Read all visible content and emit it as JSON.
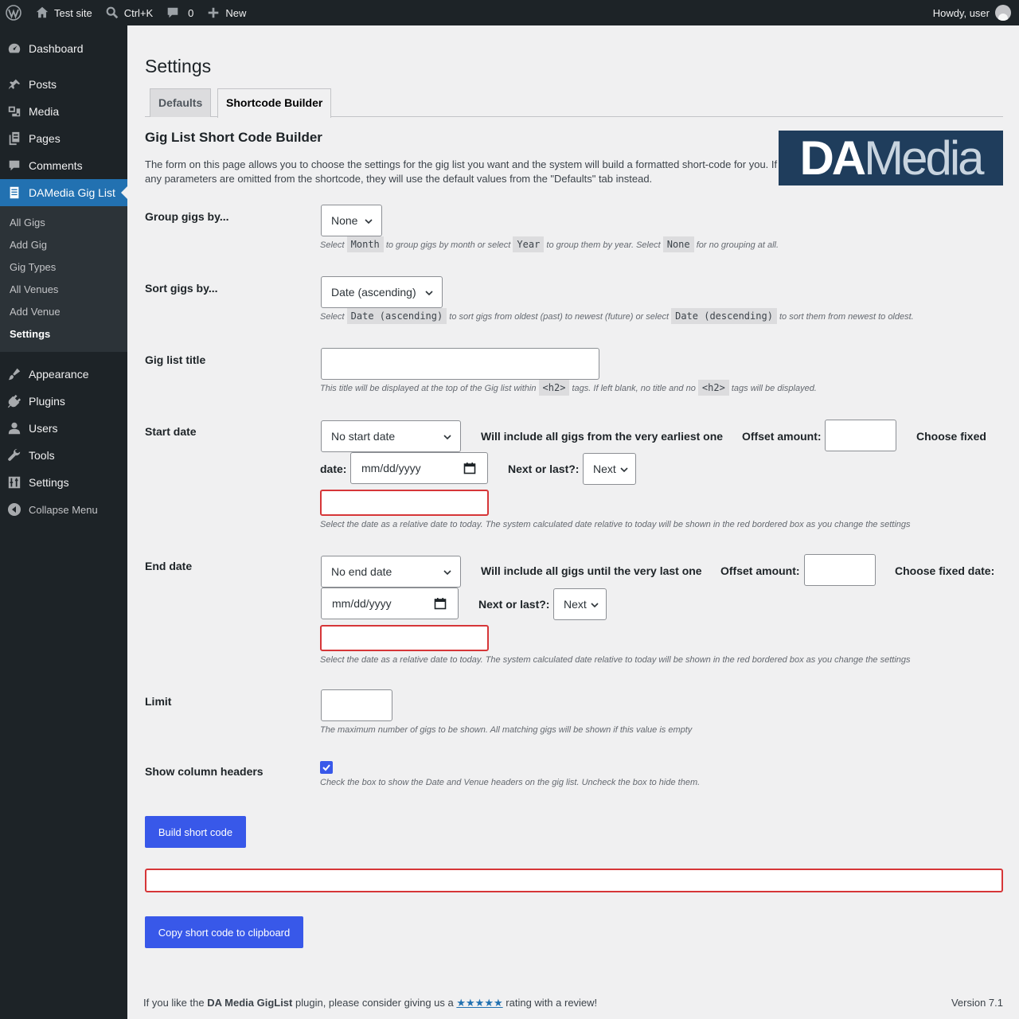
{
  "adminbar": {
    "site_name": "Test site",
    "search_shortcut": "Ctrl+K",
    "comments_count": "0",
    "new_label": "New",
    "howdy": "Howdy, user"
  },
  "sidebar": {
    "items": [
      {
        "label": "Dashboard"
      },
      {
        "label": "Posts"
      },
      {
        "label": "Media"
      },
      {
        "label": "Pages"
      },
      {
        "label": "Comments"
      },
      {
        "label": "DAMedia Gig List"
      },
      {
        "label": "Appearance"
      },
      {
        "label": "Plugins"
      },
      {
        "label": "Users"
      },
      {
        "label": "Tools"
      },
      {
        "label": "Settings"
      }
    ],
    "submenu": [
      "All Gigs",
      "Add Gig",
      "Gig Types",
      "All Venues",
      "Add Venue",
      "Settings"
    ],
    "collapse_label": "Collapse Menu"
  },
  "page": {
    "title": "Settings",
    "tabs": [
      {
        "label": "Defaults"
      },
      {
        "label": "Shortcode Builder"
      }
    ],
    "builder_title": "Gig List Short Code Builder",
    "intro": "The form on this page allows you to choose the settings for the gig list you want and the system will build a formatted short-code for you. If any parameters are omitted from the shortcode, they will use the default values from the \"Defaults\" tab instead.",
    "logo_bold": "DA",
    "logo_light": "Media"
  },
  "form": {
    "group": {
      "label": "Group gigs by...",
      "value": "None",
      "desc_1": "Select",
      "code_1": "Month",
      "desc_2": "to group gigs by month or select",
      "code_2": "Year",
      "desc_3": "to group them by year. Select",
      "code_3": "None",
      "desc_4": "for no grouping at all."
    },
    "sort": {
      "label": "Sort gigs by...",
      "value": "Date (ascending)",
      "desc_1": "Select",
      "code_1": "Date (ascending)",
      "desc_2": "to sort gigs from oldest (past) to newest (future) or select",
      "code_2": "Date (descending)",
      "desc_3": "to sort them from newest to oldest."
    },
    "title": {
      "label": "Gig list title",
      "value": "",
      "desc_1": "This title will be displayed at the top of the Gig list within",
      "code_1": "<h2>",
      "desc_2": "tags. If left blank, no title and no",
      "code_2": "<h2>",
      "desc_3": "tags will be displayed."
    },
    "start": {
      "label": "Start date",
      "value": "No start date",
      "info": "Will include all gigs from the very earliest one",
      "offset_label": "Offset amount:",
      "fixed_label_a": "Choose fixed",
      "fixed_label_b": "date:",
      "date_placeholder": "mm/dd/yyyy",
      "next_label": "Next or last?:",
      "next_value": "Next",
      "desc": "Select the date as a relative date to today. The system calculated date relative to today will be shown in the red bordered box as you change the settings"
    },
    "end": {
      "label": "End date",
      "value": "No end date",
      "info": "Will include all gigs until the very last one",
      "offset_label": "Offset amount:",
      "fixed_label": "Choose fixed date:",
      "date_placeholder": "mm/dd/yyyy",
      "next_label": "Next or last?:",
      "next_value": "Next",
      "desc": "Select the date as a relative date to today. The system calculated date relative to today will be shown in the red bordered box as you change the settings"
    },
    "limit": {
      "label": "Limit",
      "value": "",
      "desc": "The maximum number of gigs to be shown. All matching gigs will be shown if this value is empty"
    },
    "headers": {
      "label": "Show column headers",
      "checked": true,
      "desc": "Check the box to show the Date and Venue headers on the gig list. Uncheck the box to hide them."
    },
    "build_button": "Build short code",
    "copy_button": "Copy short code to clipboard"
  },
  "footer": {
    "text_1": "If you like the",
    "plugin_name": "DA Media GigList",
    "text_2": "plugin, please consider giving us a",
    "stars": "★★★★★",
    "text_3": "rating with a review!",
    "version": "Version 7.1"
  },
  "colors": {
    "accent": "#3858e9",
    "menu_current": "#2271b1",
    "error_border": "#d63638"
  }
}
